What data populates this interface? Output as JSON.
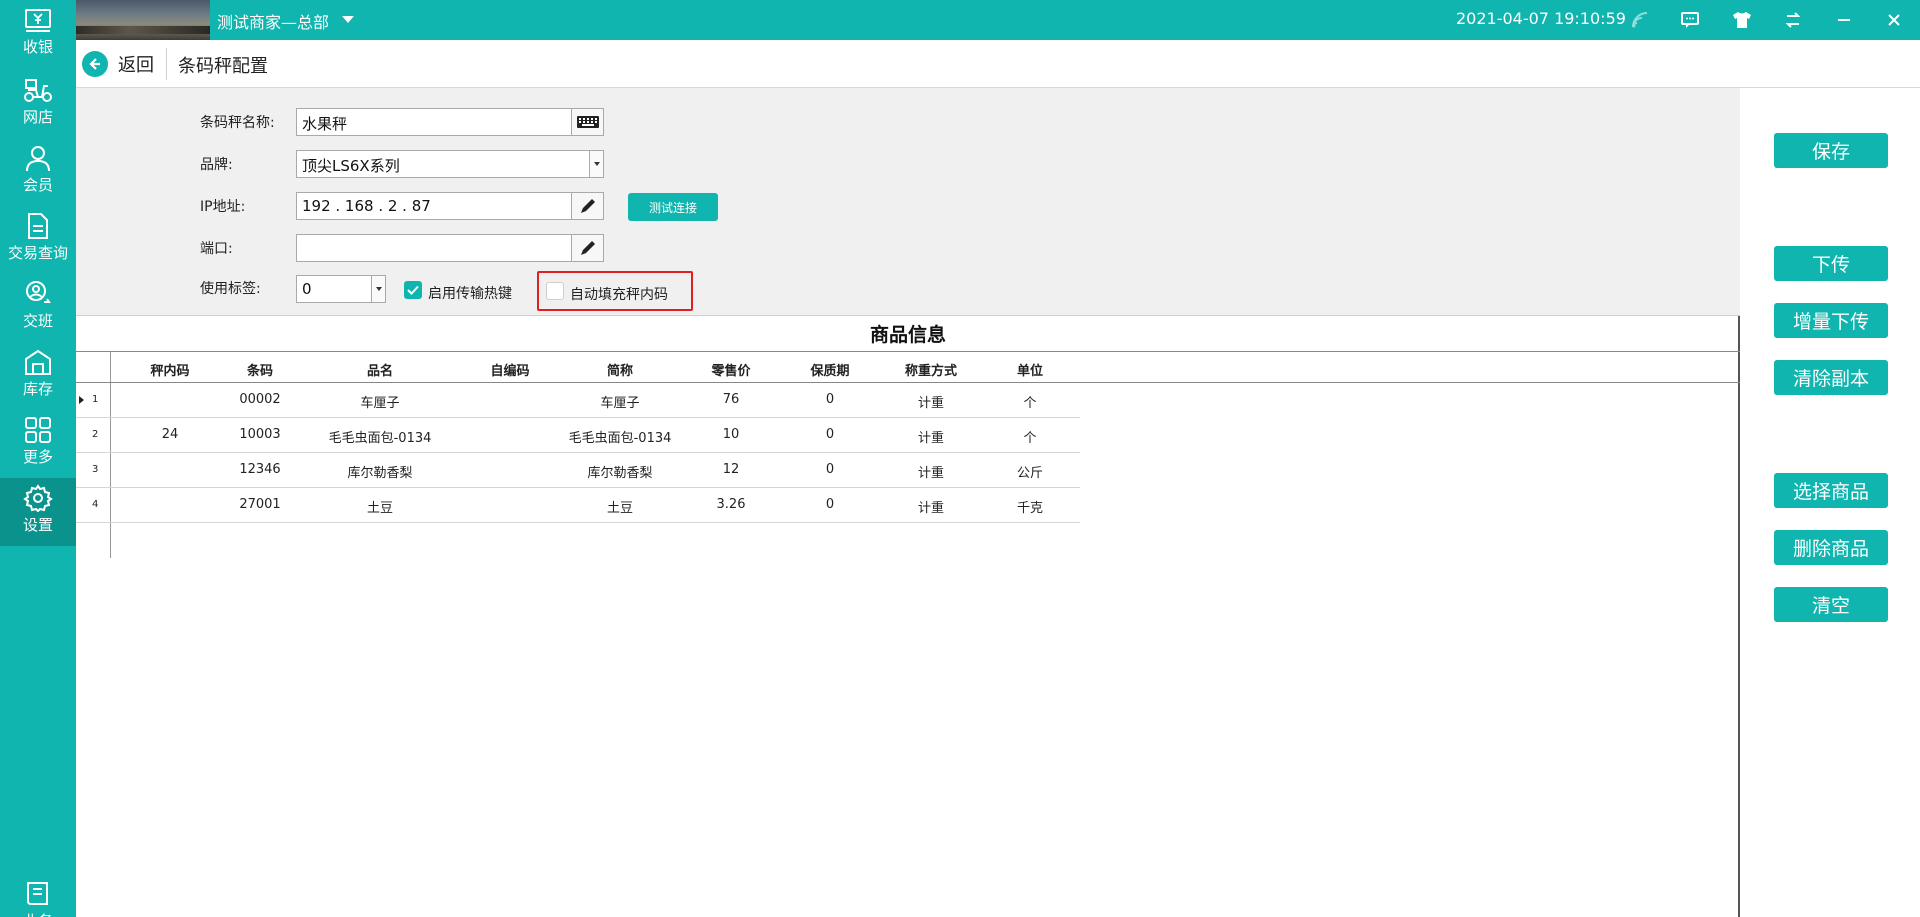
{
  "topbar": {
    "store_name": "测试商家—总部",
    "datetime": "2021-04-07 19:10:59",
    "icons": [
      "wifi-icon",
      "message-icon",
      "shirt-icon",
      "switch-icon",
      "minimize-icon",
      "close-icon"
    ]
  },
  "sidebar": {
    "items": [
      {
        "label": "收银",
        "icon": "cashier-icon"
      },
      {
        "label": "网店",
        "icon": "scooter-icon"
      },
      {
        "label": "会员",
        "icon": "person-icon"
      },
      {
        "label": "交易查询",
        "icon": "document-icon"
      },
      {
        "label": "交班",
        "icon": "handover-icon"
      },
      {
        "label": "库存",
        "icon": "warehouse-icon"
      },
      {
        "label": "更多",
        "icon": "grid-icon"
      },
      {
        "label": "设置",
        "icon": "gear-icon"
      },
      {
        "label": "业务",
        "icon": "book-icon"
      }
    ],
    "active": "设置"
  },
  "header": {
    "back_label": "返回",
    "title": "条码秤配置"
  },
  "form": {
    "name_label": "条码秤名称:",
    "name_value": "水果秤",
    "brand_label": "品牌:",
    "brand_value": "顶尖LS6X系列",
    "ip_label": "IP地址:",
    "ip_value": "192 . 168 . 2 . 87",
    "test_button": "测试连接",
    "port_label": "端口:",
    "port_value": "",
    "tag_label": "使用标签:",
    "tag_value": "0",
    "hotkey_label": "启用传输热键",
    "hotkey_checked": true,
    "autofill_label": "自动填充秤内码",
    "autofill_checked": false
  },
  "table": {
    "title": "商品信息",
    "columns": [
      "秤内码",
      "条码",
      "品名",
      "自编码",
      "简称",
      "零售价",
      "保质期",
      "称重方式",
      "单位"
    ],
    "rows": [
      {
        "num": "1",
        "inner": "",
        "barcode": "00002",
        "name": "车厘子",
        "selfcode": "",
        "short": "车厘子",
        "price": "76",
        "shelf": "0",
        "weigh": "计重",
        "unit": "个"
      },
      {
        "num": "2",
        "inner": "24",
        "barcode": "10003",
        "name": "毛毛虫面包-0134",
        "selfcode": "",
        "short": "毛毛虫面包-0134",
        "price": "10",
        "shelf": "0",
        "weigh": "计重",
        "unit": "个"
      },
      {
        "num": "3",
        "inner": "",
        "barcode": "12346",
        "name": "库尔勒香梨",
        "selfcode": "",
        "short": "库尔勒香梨",
        "price": "12",
        "shelf": "0",
        "weigh": "计重",
        "unit": "公斤"
      },
      {
        "num": "4",
        "inner": "",
        "barcode": "27001",
        "name": "土豆",
        "selfcode": "",
        "short": "土豆",
        "price": "3.26",
        "shelf": "0",
        "weigh": "计重",
        "unit": "千克"
      }
    ]
  },
  "actions": {
    "save": "保存",
    "upload": "下传",
    "incremental_upload": "增量下传",
    "clear_copy": "清除副本",
    "select_goods": "选择商品",
    "delete_goods": "删除商品",
    "clear": "清空"
  },
  "colors": {
    "accent": "#0fb5ae",
    "highlight": "#e02020"
  }
}
